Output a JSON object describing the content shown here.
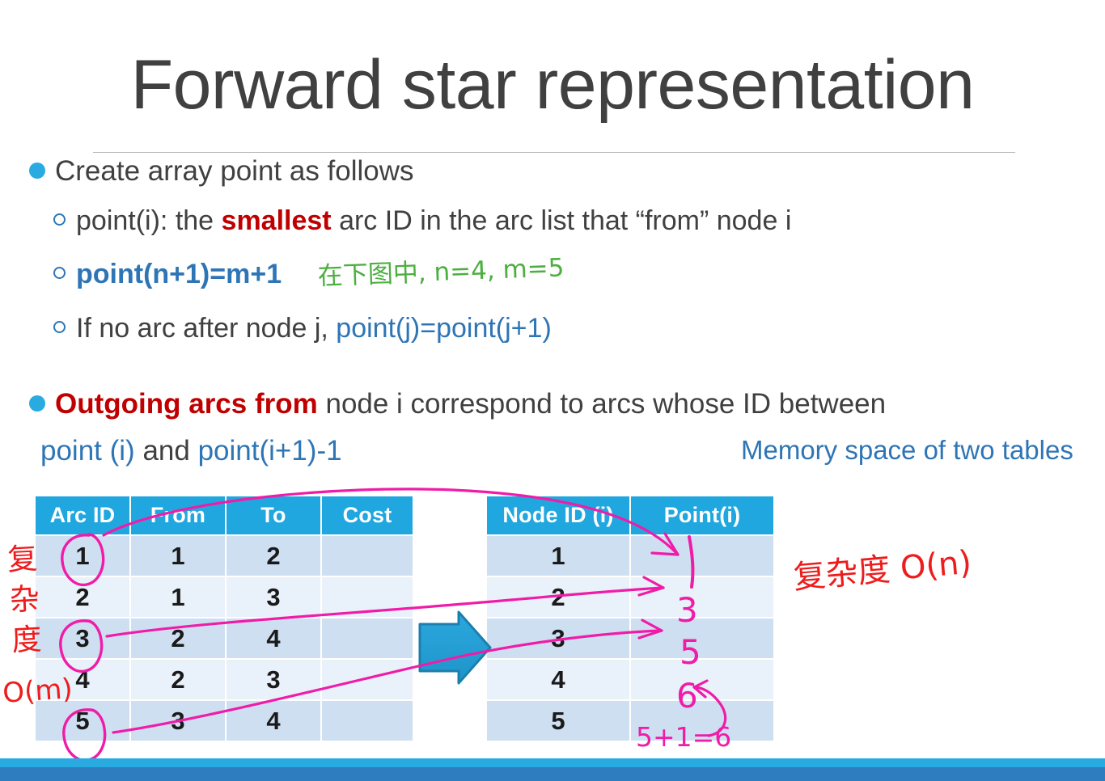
{
  "slide": {
    "title": "Forward star representation",
    "bullets": [
      {
        "level": 1,
        "id": "create-array",
        "text": "Create array point as follows"
      },
      {
        "level": 2,
        "id": "point-i-def",
        "parts": [
          {
            "text": "point(i): the ",
            "style": "normal"
          },
          {
            "text": "smallest",
            "style": "red"
          },
          {
            "text": " arc ID in the arc list that “from” node i",
            "style": "normal"
          }
        ]
      },
      {
        "level": 2,
        "id": "point-n-plus-1",
        "parts": [
          {
            "text": "point(n+1)=m+1",
            "style": "blue-bold"
          }
        ]
      },
      {
        "level": 2,
        "id": "no-arc-after",
        "parts": [
          {
            "text": "If no arc after node j, ",
            "style": "normal"
          },
          {
            "text": "point(j)=point(j+1)",
            "style": "blue"
          }
        ]
      },
      {
        "level": 1,
        "id": "outgoing-arcs",
        "parts": [
          {
            "text": "Outgoing arcs from",
            "style": "red"
          },
          {
            "text": " node i correspond to arcs whose ID between",
            "style": "normal"
          }
        ]
      },
      {
        "level": 1,
        "id": "point-range",
        "parts": [
          {
            "text": "point (i)",
            "style": "blue"
          },
          {
            "text": " and ",
            "style": "normal"
          },
          {
            "text": "point(i+1)-1",
            "style": "blue"
          }
        ]
      }
    ],
    "memory_note": "Memory space of  two tables"
  },
  "arc_table": {
    "name": "arc-list-table",
    "headers": [
      "Arc ID",
      "From",
      "To",
      "Cost"
    ],
    "rows": [
      [
        "1",
        "1",
        "2",
        ""
      ],
      [
        "2",
        "1",
        "3",
        ""
      ],
      [
        "3",
        "2",
        "4",
        ""
      ],
      [
        "4",
        "2",
        "3",
        ""
      ],
      [
        "5",
        "3",
        "4",
        ""
      ]
    ],
    "circled_arc_ids": [
      "1",
      "3",
      "5"
    ]
  },
  "point_table": {
    "name": "point-array-table",
    "headers": [
      "Node ID (i)",
      "Point(i)"
    ],
    "rows": [
      [
        "1",
        ""
      ],
      [
        "2",
        ""
      ],
      [
        "3",
        ""
      ],
      [
        "4",
        ""
      ],
      [
        "5",
        ""
      ]
    ]
  },
  "annotations": {
    "green_note": "在下图中, n=4, m=5",
    "red_complexity_vertical": "复杂度",
    "red_complexity_om": "O(m)",
    "red_complexity_on": "复杂度 O(n)",
    "magenta_point_values": {
      "row2": "3",
      "row3": "5",
      "row4": "6",
      "row5": "5+1=6"
    }
  },
  "colors": {
    "table_header": "#20A7DF",
    "row_odd": "#CEDFF1",
    "row_even": "#E9F1FA",
    "accent_blue": "#2E75B6",
    "bullet_dot": "#29ABE2",
    "red_text": "#C00000",
    "ink_magenta": "#F01CA8",
    "ink_red": "#EE1C1C",
    "ink_green": "#4CAF3F",
    "bar_light": "#29ABE2",
    "bar_dark": "#2E7DBE",
    "title_gray": "#404040"
  }
}
